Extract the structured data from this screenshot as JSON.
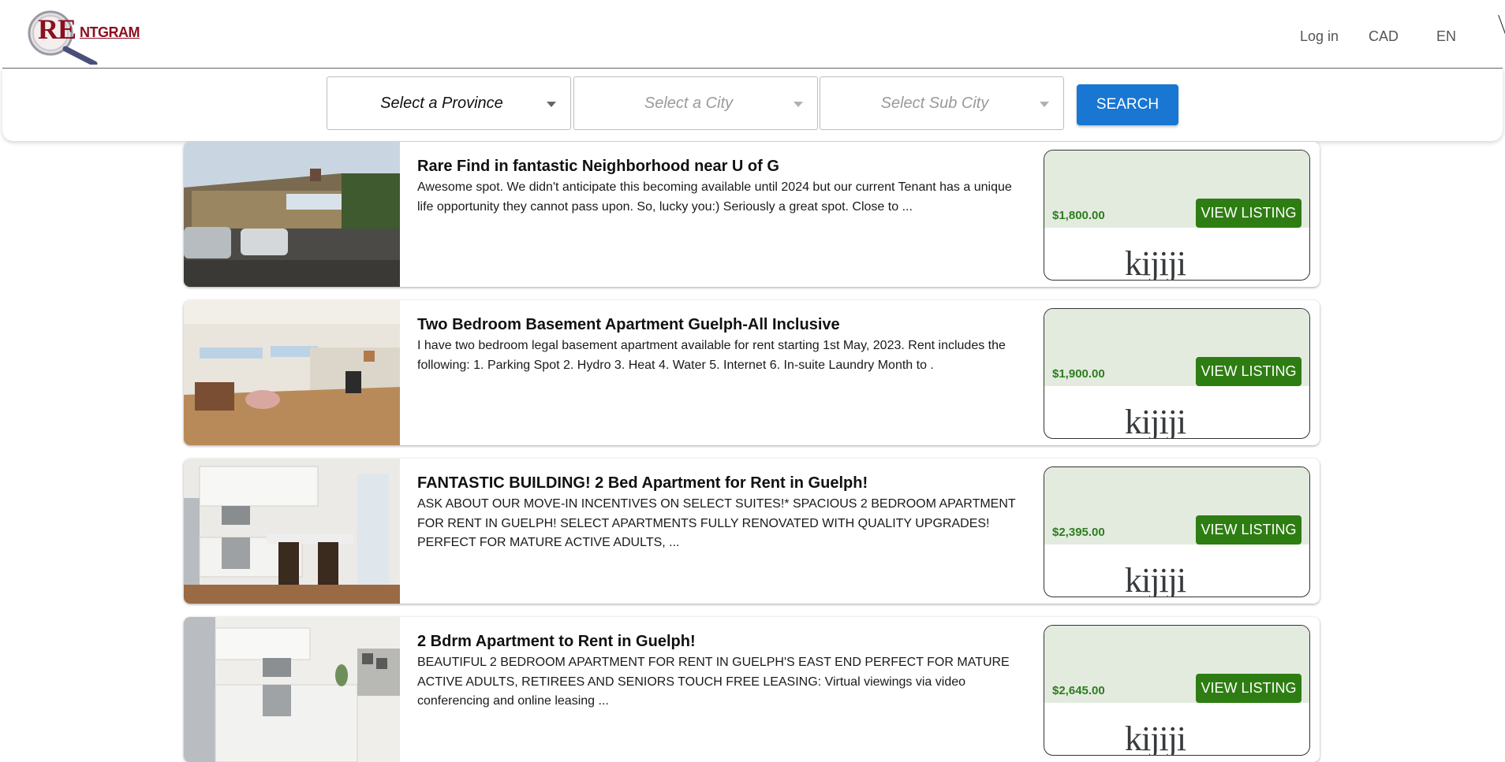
{
  "header": {
    "logo_text_big": "RE",
    "logo_text_rest": "NTGRAM",
    "nav": {
      "login": "Log in",
      "currency": "CAD",
      "language": "EN"
    }
  },
  "search": {
    "province_placeholder": "Select a Province",
    "city_placeholder": "Select a City",
    "subcity_placeholder": "Select Sub City",
    "search_label": "SEARCH"
  },
  "listings": [
    {
      "title": "Rare Find in fantastic Neighborhood near U of G",
      "description": "Awesome spot. We didn't anticipate this becoming available until 2024 but our current Tenant has a unique life opportunity they cannot pass upon. So, lucky you:) Seriously a great spot. Close to ...",
      "price": "$1,800.00",
      "button": "VIEW LISTING",
      "source": "kijiji"
    },
    {
      "title": "Two Bedroom Basement Apartment Guelph-All Inclusive",
      "description": "I have two bedroom legal basement apartment available for rent starting 1st May, 2023. Rent includes the following: 1. Parking Spot 2. Hydro 3. Heat 4. Water 5. Internet 6. In-suite Laundry Month to .",
      "price": "$1,900.00",
      "button": "VIEW LISTING",
      "source": "kijiji"
    },
    {
      "title": "FANTASTIC BUILDING! 2 Bed Apartment for Rent in Guelph!",
      "description": "ASK ABOUT OUR MOVE-IN INCENTIVES ON SELECT SUITES!* SPACIOUS 2 BEDROOM APARTMENT FOR RENT IN GUELPH! SELECT APARTMENTS FULLY RENOVATED WITH QUALITY UPGRADES! PERFECT FOR MATURE ACTIVE ADULTS, ...",
      "price": "$2,395.00",
      "button": "VIEW LISTING",
      "source": "kijiji"
    },
    {
      "title": "2 Bdrm Apartment to Rent in Guelph!",
      "description": "BEAUTIFUL 2 BEDROOM APARTMENT FOR RENT IN GUELPH'S EAST END PERFECT FOR MATURE ACTIVE ADULTS, RETIREES AND SENIORS TOUCH FREE LEASING: Virtual viewings via video conferencing and online leasing ...",
      "price": "$2,645.00",
      "button": "VIEW LISTING",
      "source": "kijiji"
    }
  ],
  "colors": {
    "brand": "#8b1020",
    "search_button": "#1976d2",
    "view_button": "#2e7d12",
    "price": "#2e7d1e",
    "price_panel": "#e3ebdf"
  }
}
